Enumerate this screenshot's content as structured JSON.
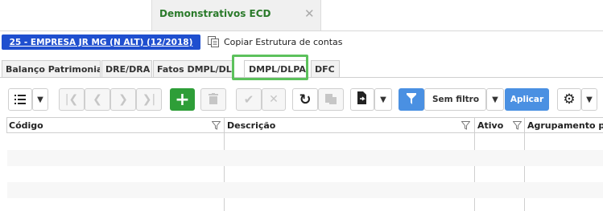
{
  "tab": {
    "title": "Demonstrativos ECD",
    "close_icon": "close-icon"
  },
  "company": {
    "label": "25 - EMPRESA JR MG (N ALT) (12/2018)"
  },
  "copy_structure": {
    "label": "Copiar Estrutura de contas",
    "icon": "copy-structure-icon"
  },
  "subtabs": [
    {
      "label": "Balanço Patrimonial"
    },
    {
      "label": "DRE/DRA"
    },
    {
      "label": "Fatos DMPL/DLPA"
    },
    {
      "label": "DMPL/DLPA",
      "active": true
    },
    {
      "label": "DFC"
    }
  ],
  "toolbar": {
    "filter_select": "Sem filtro",
    "apply_label": "Aplicar",
    "icons": [
      "list-view-icon",
      "first-page-icon",
      "previous-page-icon",
      "next-page-icon",
      "last-page-icon",
      "add-icon",
      "delete-icon",
      "confirm-icon",
      "cancel-icon",
      "refresh-icon",
      "paste-icon",
      "export-icon",
      "filter-icon",
      "settings-icon"
    ]
  },
  "grid": {
    "columns": [
      {
        "label": "Código"
      },
      {
        "label": "Descrição"
      },
      {
        "label": "Ativo"
      },
      {
        "label": "Agrupamento p/"
      }
    ]
  },
  "colors": {
    "accent_green": "#2a7a2a",
    "brand_blue": "#1f4fcf",
    "button_blue": "#4a90e2",
    "add_green": "#2e9e38",
    "highlight": "#5cc15c"
  }
}
